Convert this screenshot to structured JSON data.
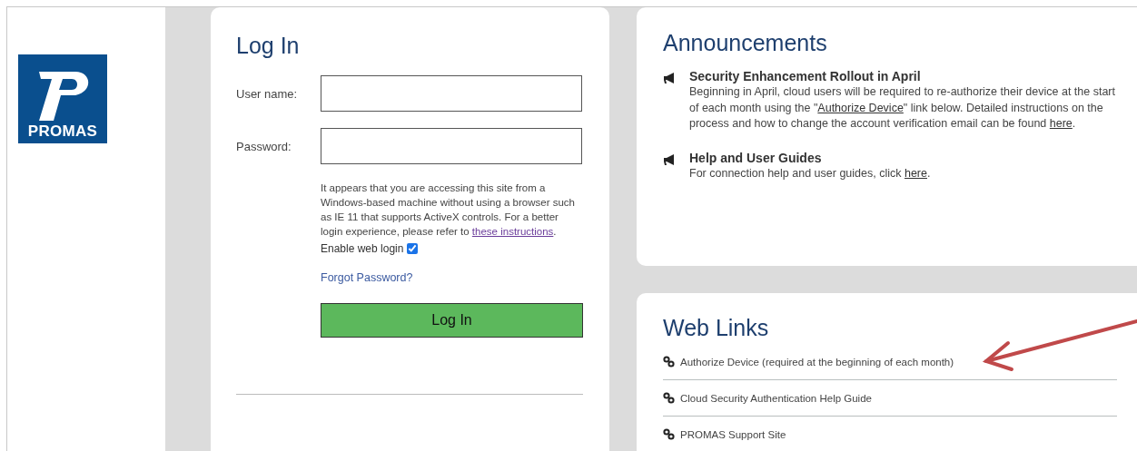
{
  "logo": {
    "text": "PROMAS"
  },
  "login": {
    "title": "Log In",
    "fields": [
      {
        "label": "User name:"
      },
      {
        "label": "Password:"
      }
    ],
    "notice": [
      {
        "kind": "text",
        "text": "It appears that you are accessing this site from a Windows-based machine without using a browser such as IE 11 that supports ActiveX controls. For a better login experience, please refer to "
      },
      {
        "kind": "visited_link",
        "text": "these instructions"
      },
      {
        "kind": "text",
        "text": "."
      }
    ],
    "enable_web_login": {
      "label": "Enable web login",
      "checked": true
    },
    "forgot_link": "Forgot Password?",
    "submit": "Log In"
  },
  "announcements": {
    "title": "Announcements",
    "items": [
      {
        "heading": "Security Enhancement Rollout in April",
        "body": [
          {
            "kind": "text",
            "text": "Beginning in April, cloud users will be required to re-authorize their device at the start of each month using the \""
          },
          {
            "kind": "link",
            "text": "Authorize Device"
          },
          {
            "kind": "text",
            "text": "\" link below. Detailed instructions on the process and how to change the account verification email can be found "
          },
          {
            "kind": "link",
            "text": "here"
          },
          {
            "kind": "text",
            "text": "."
          }
        ]
      },
      {
        "heading": "Help and User Guides",
        "body": [
          {
            "kind": "text",
            "text": "For connection help and user guides, click "
          },
          {
            "kind": "link",
            "text": "here"
          },
          {
            "kind": "text",
            "text": "."
          }
        ]
      }
    ]
  },
  "web_links": {
    "title": "Web Links",
    "items": [
      "Authorize Device (required at the beginning of each month)",
      "Cloud Security Authentication Help Guide",
      "PROMAS Support Site"
    ]
  }
}
